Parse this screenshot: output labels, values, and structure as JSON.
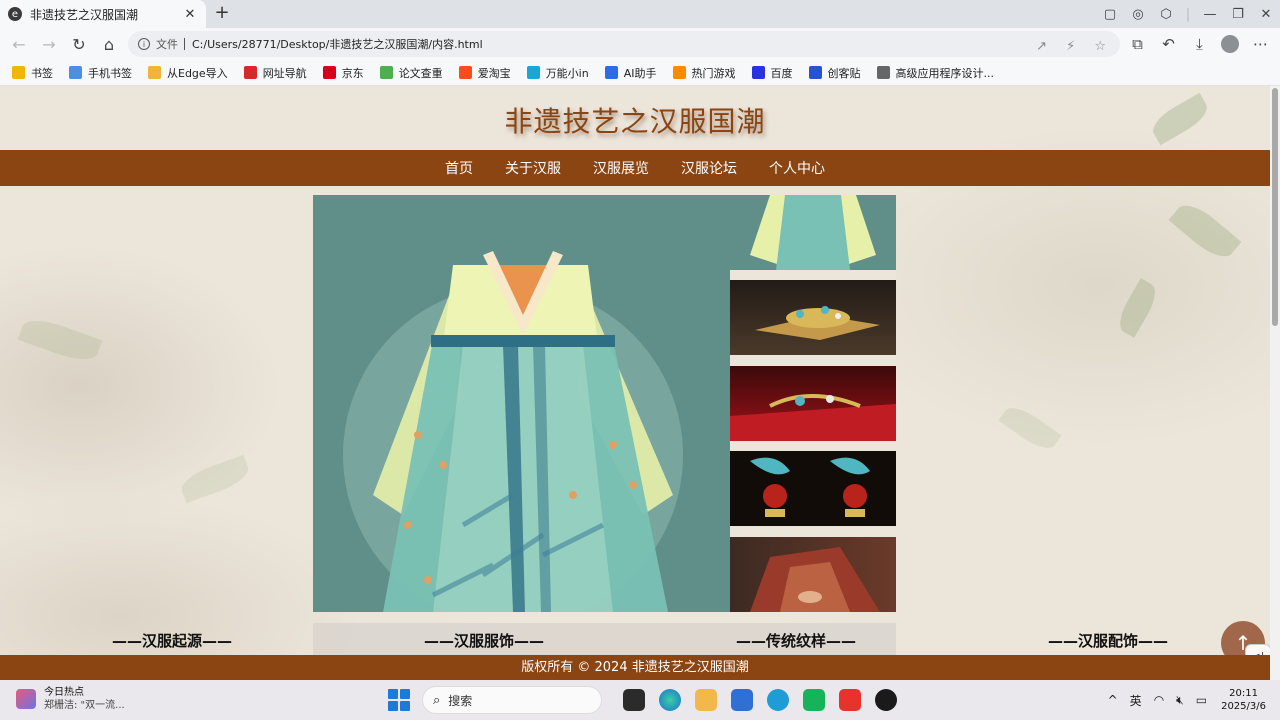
{
  "browser": {
    "tab_title": "非遗技艺之汉服国潮",
    "file_label": "文件",
    "url": "C:/Users/28771/Desktop/非遗技艺之汉服国潮/内容.html"
  },
  "bookmarks": [
    {
      "label": "书签",
      "color": "#f2b600"
    },
    {
      "label": "手机书签",
      "color": "#4a90e2"
    },
    {
      "label": "从Edge导入",
      "color": "#f0b43a"
    },
    {
      "label": "网址导航",
      "color": "#d62a2a"
    },
    {
      "label": "京东",
      "color": "#d6001c"
    },
    {
      "label": "论文查重",
      "color": "#4caf50"
    },
    {
      "label": "爱淘宝",
      "color": "#ff4a1a"
    },
    {
      "label": "万能小in",
      "color": "#19a7d4"
    },
    {
      "label": "AI助手",
      "color": "#2b6de8"
    },
    {
      "label": "热门游戏",
      "color": "#ff8a00"
    },
    {
      "label": "百度",
      "color": "#2932e1"
    },
    {
      "label": "创客贴",
      "color": "#2453d6"
    },
    {
      "label": "高级应用程序设计...",
      "color": "#666666"
    }
  ],
  "site": {
    "title": "非遗技艺之汉服国潮",
    "nav": [
      "首页",
      "关于汉服",
      "汉服展览",
      "汉服论坛",
      "个人中心"
    ],
    "categories": [
      "——汉服起源——",
      "——汉服服饰——",
      "——传统纹样——",
      "——汉服配饰——"
    ],
    "footer": "版权所有 © 2024 非遗技艺之汉服国潮",
    "colors": {
      "brand": "#8b4513",
      "hero_bg": "#5f8f88"
    }
  },
  "taskbar": {
    "news_title": "今日热点",
    "news_sub": "郑栅洁: \"双一流...",
    "search_placeholder": "搜索",
    "ime": "英",
    "time": "20:11",
    "date": "2025/3/6"
  }
}
